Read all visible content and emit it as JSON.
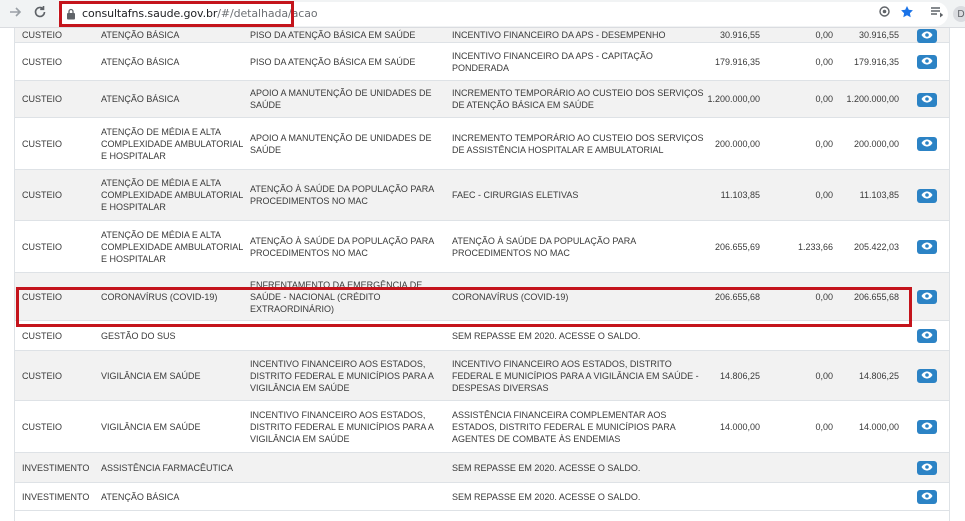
{
  "browser": {
    "url_host": "consultafns.saude.gov.br",
    "url_path": "/#/detalhada/acao",
    "profile_initial": "D"
  },
  "icons": {
    "forward": "arrow-right-icon",
    "reload": "reload-icon",
    "lock": "lock-icon",
    "location": "target-icon",
    "bookmark": "star-icon",
    "media": "playlist-icon",
    "view": "eye-icon"
  },
  "colors": {
    "highlight": "#c4141c",
    "view_button": "#2c83c5"
  },
  "rows": [
    {
      "tipo": "CUSTEIO",
      "bloco": "ATENÇÃO BÁSICA",
      "grupo": "PISO DA ATENÇÃO BÁSICA EM SAÚDE",
      "acao": "INCENTIVO FINANCEIRO DA APS - DESEMPENHO",
      "v1": "30.916,55",
      "v2": "0,00",
      "v3": "30.916,55"
    },
    {
      "tipo": "CUSTEIO",
      "bloco": "ATENÇÃO BÁSICA",
      "grupo": "PISO DA ATENÇÃO BÁSICA EM SAÚDE",
      "acao": "INCENTIVO FINANCEIRO DA APS - CAPITAÇÃO PONDERADA",
      "v1": "179.916,35",
      "v2": "0,00",
      "v3": "179.916,35"
    },
    {
      "tipo": "CUSTEIO",
      "bloco": "ATENÇÃO BÁSICA",
      "grupo": "APOIO A MANUTENÇÃO DE UNIDADES DE SAÚDE",
      "acao": "INCREMENTO TEMPORÁRIO AO CUSTEIO DOS SERVIÇOS DE ATENÇÃO BÁSICA EM SAÚDE",
      "v1": "1.200.000,00",
      "v2": "0,00",
      "v3": "1.200.000,00"
    },
    {
      "tipo": "CUSTEIO",
      "bloco": "ATENÇÃO DE MÉDIA E ALTA COMPLEXIDADE AMBULATORIAL E HOSPITALAR",
      "grupo": "APOIO A MANUTENÇÃO DE UNIDADES DE SAÚDE",
      "acao": "INCREMENTO TEMPORÁRIO AO CUSTEIO DOS SERVIÇOS DE ASSISTÊNCIA HOSPITALAR E AMBULATORIAL",
      "v1": "200.000,00",
      "v2": "0,00",
      "v3": "200.000,00"
    },
    {
      "tipo": "CUSTEIO",
      "bloco": "ATENÇÃO DE MÉDIA E ALTA COMPLEXIDADE AMBULATORIAL E HOSPITALAR",
      "grupo": "ATENÇÃO À SAÚDE DA POPULAÇÃO PARA PROCEDIMENTOS NO MAC",
      "acao": "FAEC - CIRURGIAS ELETIVAS",
      "v1": "11.103,85",
      "v2": "0,00",
      "v3": "11.103,85"
    },
    {
      "tipo": "CUSTEIO",
      "bloco": "ATENÇÃO DE MÉDIA E ALTA COMPLEXIDADE AMBULATORIAL E HOSPITALAR",
      "grupo": "ATENÇÃO À SAÚDE DA POPULAÇÃO PARA PROCEDIMENTOS NO MAC",
      "acao": "ATENÇÃO À SAÚDE DA POPULAÇÃO PARA PROCEDIMENTOS NO MAC",
      "v1": "206.655,69",
      "v2": "1.233,66",
      "v3": "205.422,03"
    },
    {
      "tipo": "CUSTEIO",
      "bloco": "CORONAVÍRUS (COVID-19)",
      "grupo": "ENFRENTAMENTO DA EMERGÊNCIA DE SAÚDE - NACIONAL (CRÉDITO EXTRAORDINÁRIO)",
      "acao": "CORONAVÍRUS (COVID-19)",
      "v1": "206.655,68",
      "v2": "0,00",
      "v3": "206.655,68"
    },
    {
      "tipo": "CUSTEIO",
      "bloco": "GESTÃO DO SUS",
      "grupo": "",
      "acao": "SEM REPASSE EM 2020. ACESSE O SALDO.",
      "v1": "",
      "v2": "",
      "v3": ""
    },
    {
      "tipo": "CUSTEIO",
      "bloco": "VIGILÂNCIA EM SAÚDE",
      "grupo": "INCENTIVO FINANCEIRO AOS ESTADOS, DISTRITO FEDERAL E MUNICÍPIOS PARA A VIGILÂNCIA EM SAÚDE",
      "acao": "INCENTIVO FINANCEIRO AOS ESTADOS, DISTRITO FEDERAL E MUNICÍPIOS PARA A VIGILÂNCIA EM SAÚDE - DESPESAS DIVERSAS",
      "v1": "14.806,25",
      "v2": "0,00",
      "v3": "14.806,25"
    },
    {
      "tipo": "CUSTEIO",
      "bloco": "VIGILÂNCIA EM SAÚDE",
      "grupo": "INCENTIVO FINANCEIRO AOS ESTADOS, DISTRITO FEDERAL E MUNICÍPIOS PARA A VIGILÂNCIA EM SAÚDE",
      "acao": "ASSISTÊNCIA FINANCEIRA COMPLEMENTAR AOS ESTADOS, DISTRITO FEDERAL E MUNICÍPIOS PARA AGENTES DE COMBATE ÀS ENDEMIAS",
      "v1": "14.000,00",
      "v2": "0,00",
      "v3": "14.000,00"
    },
    {
      "tipo": "INVESTIMENTO",
      "bloco": "ASSISTÊNCIA FARMACÊUTICA",
      "grupo": "",
      "acao": "SEM REPASSE EM 2020. ACESSE O SALDO.",
      "v1": "",
      "v2": "",
      "v3": ""
    },
    {
      "tipo": "INVESTIMENTO",
      "bloco": "ATENÇÃO BÁSICA",
      "grupo": "",
      "acao": "SEM REPASSE EM 2020. ACESSE O SALDO.",
      "v1": "",
      "v2": "",
      "v3": ""
    }
  ]
}
